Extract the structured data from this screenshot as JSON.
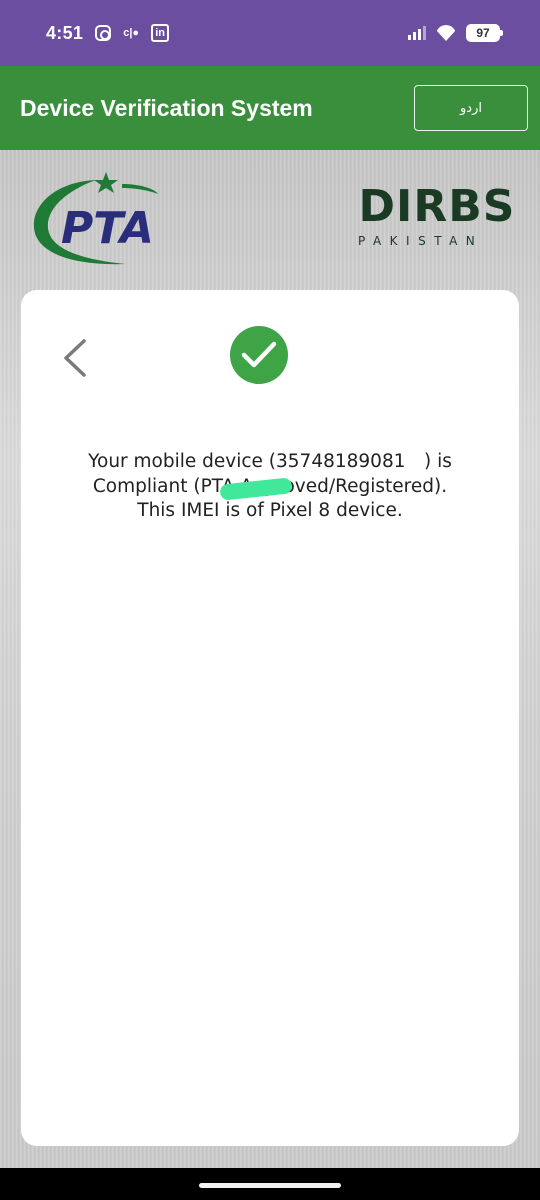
{
  "status_bar": {
    "time": "4:51",
    "cast_label": "c|●",
    "linkedin_label": "in",
    "battery_level": "97"
  },
  "app_bar": {
    "title": "Device Verification System",
    "language_button": "اردو"
  },
  "logos": {
    "pta": "PTA",
    "dirbs": "DIRBS",
    "dirbs_sub": "PAKISTAN"
  },
  "result": {
    "status": "compliant",
    "message": "Your mobile device (35748189081     ) is Compliant (PTA Approved/Registered). This IMEI is of Pixel 8 device."
  },
  "colors": {
    "status_bar": "#6b4ea0",
    "app_bar": "#3a8f3c",
    "success": "#3fa446",
    "pta_green": "#1f7a36",
    "pta_blue": "#2a2e7a",
    "dirbs_green": "#1a3a24"
  }
}
